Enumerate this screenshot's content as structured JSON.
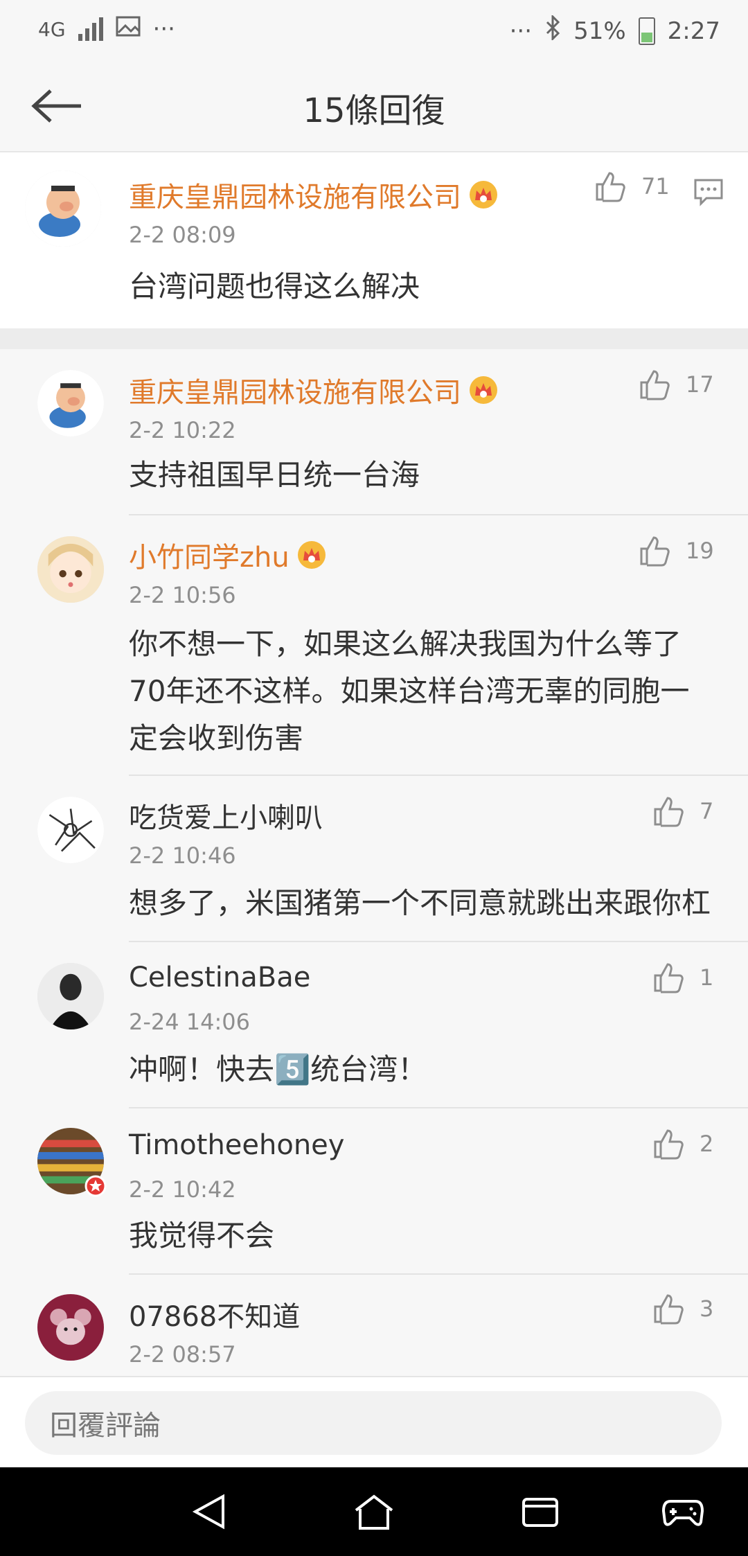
{
  "status_bar": {
    "network": "4G",
    "dots_left": "···",
    "dots_right": "···",
    "battery": "51%",
    "time": "2:27"
  },
  "header": {
    "title": "15條回復"
  },
  "main_comment": {
    "name": "重庆皇鼎园林设施有限公司",
    "time": "2-2 08:09",
    "text": "台湾问题也得这么解决",
    "likes": "71"
  },
  "replies": [
    {
      "name": "重庆皇鼎园林设施有限公司",
      "time": "2-2 10:22",
      "text": "支持祖国早日统一台海",
      "likes": "17",
      "vip": true
    },
    {
      "name": "小竹同学zhu",
      "time": "2-2 10:56",
      "text": "你不想一下，如果这么解决我国为什么等了70年还不这样。如果这样台湾无辜的同胞一定会收到伤害",
      "likes": "19",
      "vip": true
    },
    {
      "name": "吃货爱上小喇叭",
      "time": "2-2 10:46",
      "text": "想多了，米国猪第一个不同意就跳出来跟你杠",
      "likes": "7",
      "vip": false
    },
    {
      "name": "CelestinaBae",
      "time": "2-24 14:06",
      "text": "冲啊！快去5️⃣统台湾！",
      "likes": "1",
      "vip": false
    },
    {
      "name": "Timotheehoney",
      "time": "2-2 10:42",
      "text": "我觉得不会",
      "likes": "2",
      "vip": false
    },
    {
      "name": "07868不知道",
      "time": "2-2 08:57",
      "text": "",
      "likes": "3",
      "vip": false
    }
  ],
  "reply_bar": {
    "placeholder": "回覆評論"
  },
  "colors": {
    "vip_name": "#e07a2b",
    "gray_text": "#8e8e8e"
  },
  "icons": {
    "back": "back-arrow-icon",
    "like": "thumbs-up-icon",
    "reply": "comment-bubble-icon",
    "crown": "vip-crown-icon"
  }
}
